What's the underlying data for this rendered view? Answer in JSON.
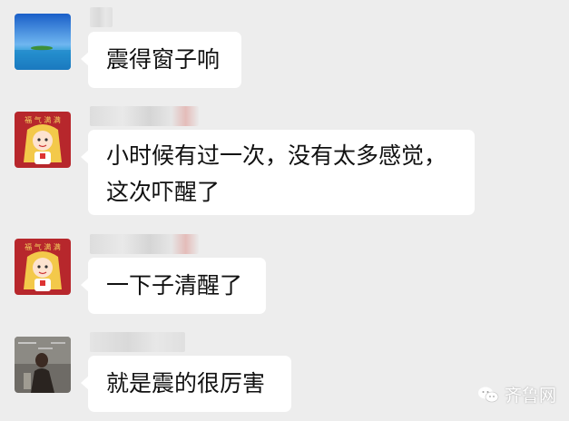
{
  "messages": [
    {
      "id": "m1",
      "avatar": "ocean-island-avatar",
      "lines": [
        "震得窗子响"
      ]
    },
    {
      "id": "m2",
      "avatar": "cartoon-girl-avatar",
      "lines": [
        "小时候有过一次，没有太多感觉，",
        "这次吓醒了"
      ]
    },
    {
      "id": "m3",
      "avatar": "cartoon-girl-avatar",
      "lines": [
        "一下子清醒了"
      ]
    },
    {
      "id": "m4",
      "avatar": "photo-avatar",
      "lines": [
        "就是震的很厉害"
      ]
    }
  ],
  "watermark": {
    "label": "齐鲁网",
    "icon": "wechat-icon"
  },
  "colors": {
    "background": "#ededed",
    "bubble": "#ffffff",
    "text": "#111111"
  }
}
